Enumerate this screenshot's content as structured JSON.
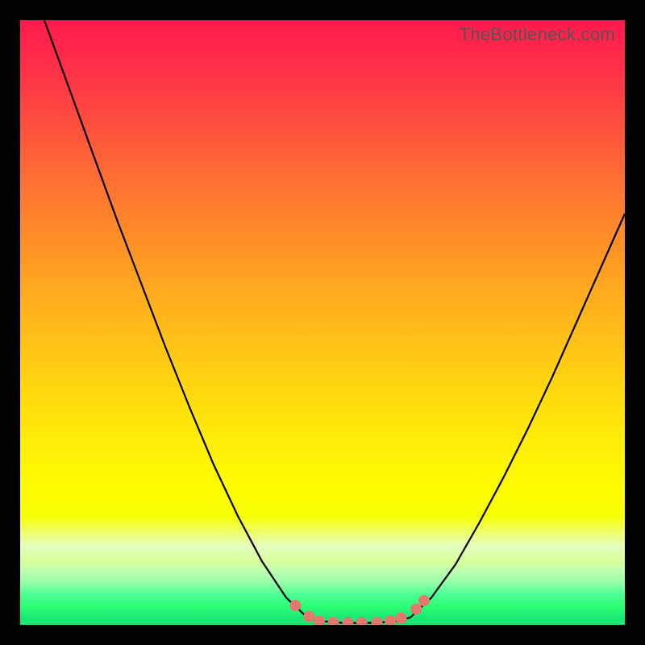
{
  "watermark": "TheBottleneck.com",
  "colors": {
    "frame": "#000000",
    "gradient_top": "#ff1a4d",
    "gradient_bottom": "#17e876",
    "curve": "#000000",
    "marker": "#e3786f"
  },
  "chart_data": {
    "type": "line",
    "title": "",
    "xlabel": "",
    "ylabel": "",
    "xlim": [
      0,
      100
    ],
    "ylim": [
      0,
      100
    ],
    "series": [
      {
        "name": "left-descent",
        "x": [
          4,
          8,
          12,
          16,
          20,
          24,
          28,
          32,
          36,
          40,
          44,
          47.5
        ],
        "y": [
          100,
          89,
          78,
          67,
          56.5,
          46,
          36,
          26.5,
          18,
          10.5,
          4.5,
          1.2
        ]
      },
      {
        "name": "valley-floor",
        "x": [
          47.5,
          50,
          53,
          56,
          59,
          62,
          64.5
        ],
        "y": [
          1.2,
          0.6,
          0.35,
          0.3,
          0.35,
          0.6,
          1.2
        ]
      },
      {
        "name": "right-ascent",
        "x": [
          64.5,
          68,
          72,
          76,
          80,
          84,
          88,
          92,
          96,
          100
        ],
        "y": [
          1.2,
          4.5,
          10,
          17,
          24.5,
          32.5,
          41,
          50,
          59,
          68
        ]
      }
    ],
    "markers": {
      "name": "valley-markers",
      "points": [
        {
          "x": 45.5,
          "y": 3.2
        },
        {
          "x": 47.8,
          "y": 1.4
        },
        {
          "x": 49.5,
          "y": 0.6
        },
        {
          "x": 51.8,
          "y": 0.4
        },
        {
          "x": 54.2,
          "y": 0.35
        },
        {
          "x": 56.5,
          "y": 0.35
        },
        {
          "x": 59.0,
          "y": 0.4
        },
        {
          "x": 61.2,
          "y": 0.65
        },
        {
          "x": 63.0,
          "y": 1.1
        },
        {
          "x": 65.5,
          "y": 2.6
        },
        {
          "x": 66.8,
          "y": 4.0
        }
      ]
    }
  }
}
